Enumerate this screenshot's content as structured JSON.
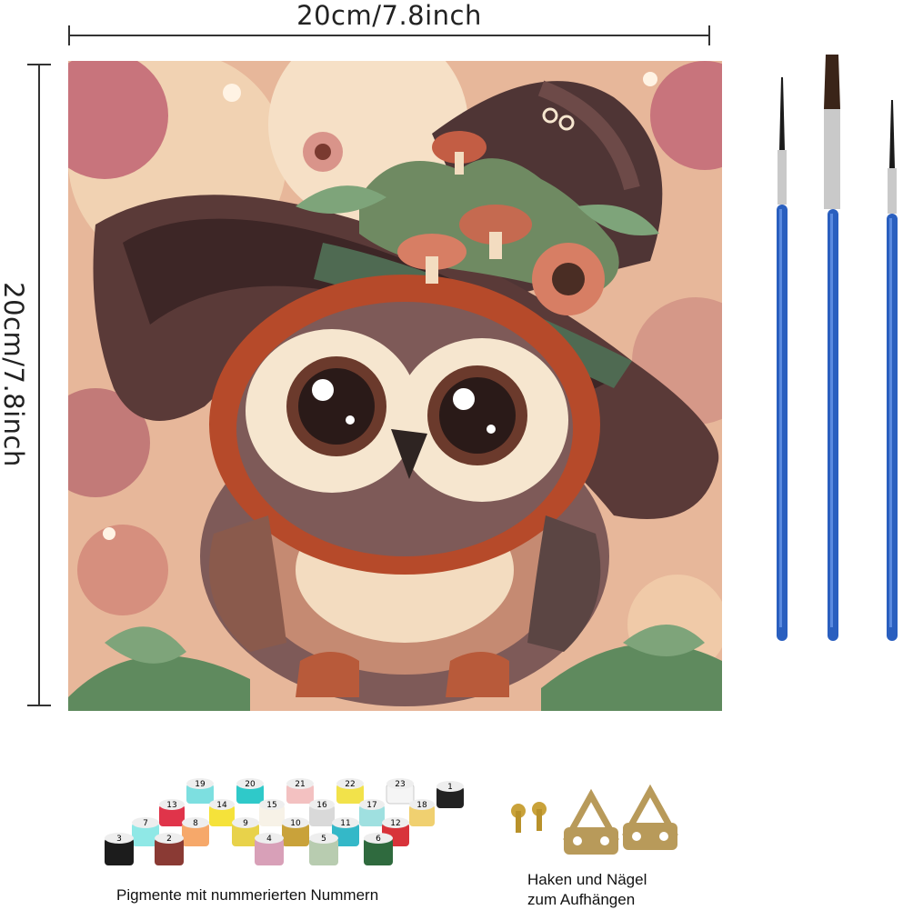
{
  "dimensions": {
    "width_label": "20cm/7.8inch",
    "height_label": "20cm/7.8inch"
  },
  "painting": {
    "subject": "owl-with-mushroom-hat",
    "colors": {
      "background_light": "#f3d8b8",
      "background_pink": "#c8747c",
      "hat": "#5a3a38",
      "hat_band": "#4f6a52",
      "owl_face": "#f6e6cf",
      "owl_body": "#7e5a58",
      "owl_rust": "#b64a2a",
      "eye": "#2a1a18",
      "leaf": "#5f8a5e",
      "flower": "#d77e64"
    }
  },
  "brushes": {
    "count": 3,
    "handle_color": "#2a5fbf"
  },
  "paint_pots": {
    "numbers": [
      "19",
      "20",
      "21",
      "22",
      "23",
      "1",
      "13",
      "14",
      "15",
      "16",
      "17",
      "18",
      "7",
      "8",
      "9",
      "10",
      "11",
      "12",
      "3",
      "2",
      "4",
      "5",
      "6"
    ],
    "caption": "Pigmente mit nummerierten Nummern"
  },
  "hooks": {
    "caption_line1": "Haken und Nägel",
    "caption_line2": "zum Aufhängen"
  }
}
